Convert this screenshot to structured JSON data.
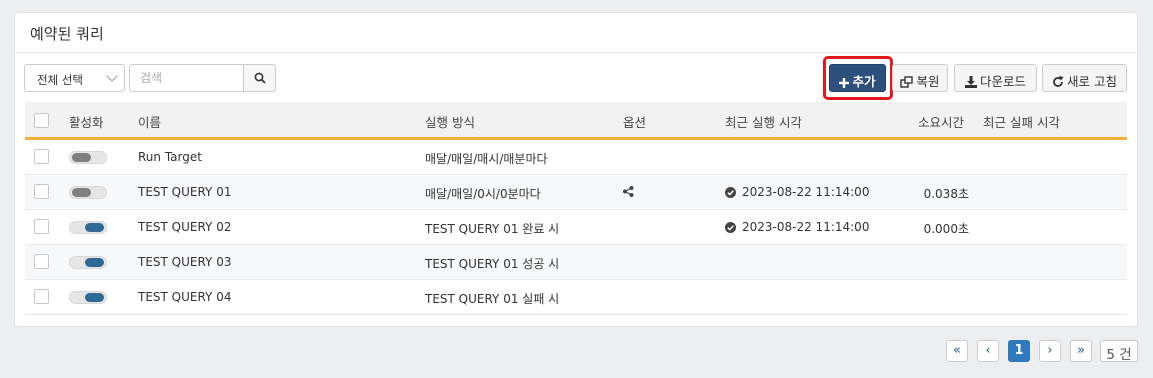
{
  "panel": {
    "title": "예약된 쿼리"
  },
  "toolbar": {
    "filter_select": "전체 선택",
    "search_placeholder": "검색",
    "add_label": "추가",
    "restore_label": "복원",
    "download_label": "다운로드",
    "refresh_label": "새로 고침"
  },
  "table": {
    "headers": {
      "active": "활성화",
      "name": "이름",
      "method": "실행 방식",
      "options": "옵션",
      "last_run": "최근 실행 시각",
      "duration": "소요시간",
      "last_fail": "최근 실패 시각"
    },
    "rows": [
      {
        "active": false,
        "name": "Run Target",
        "method": "매달/매일/매시/매분마다",
        "options": "",
        "last_run": "",
        "duration": "",
        "last_fail": ""
      },
      {
        "active": false,
        "name": "TEST QUERY 01",
        "method": "매달/매일/0시/0분마다",
        "options": "share-icon",
        "last_run": "2023-08-22 11:14:00",
        "duration": "0.038초",
        "last_fail": ""
      },
      {
        "active": true,
        "name": "TEST QUERY 02",
        "method": "TEST QUERY 01 완료 시",
        "options": "",
        "last_run": "2023-08-22 11:14:00",
        "duration": "0.000초",
        "last_fail": ""
      },
      {
        "active": true,
        "name": "TEST QUERY 03",
        "method": "TEST QUERY 01 성공 시",
        "options": "",
        "last_run": "",
        "duration": "",
        "last_fail": ""
      },
      {
        "active": true,
        "name": "TEST QUERY 04",
        "method": "TEST QUERY 01 실패 시",
        "options": "",
        "last_run": "",
        "duration": "",
        "last_fail": ""
      }
    ]
  },
  "pagination": {
    "first": "«",
    "prev": "‹",
    "current": "1",
    "next": "›",
    "last": "»",
    "total": "5 건"
  },
  "colors": {
    "add_button": "#2d4f7c",
    "highlight": "#e5191d",
    "header_accent": "#f0b236",
    "toggle_on": "#2f6a94",
    "page_active": "#2f79bd"
  }
}
